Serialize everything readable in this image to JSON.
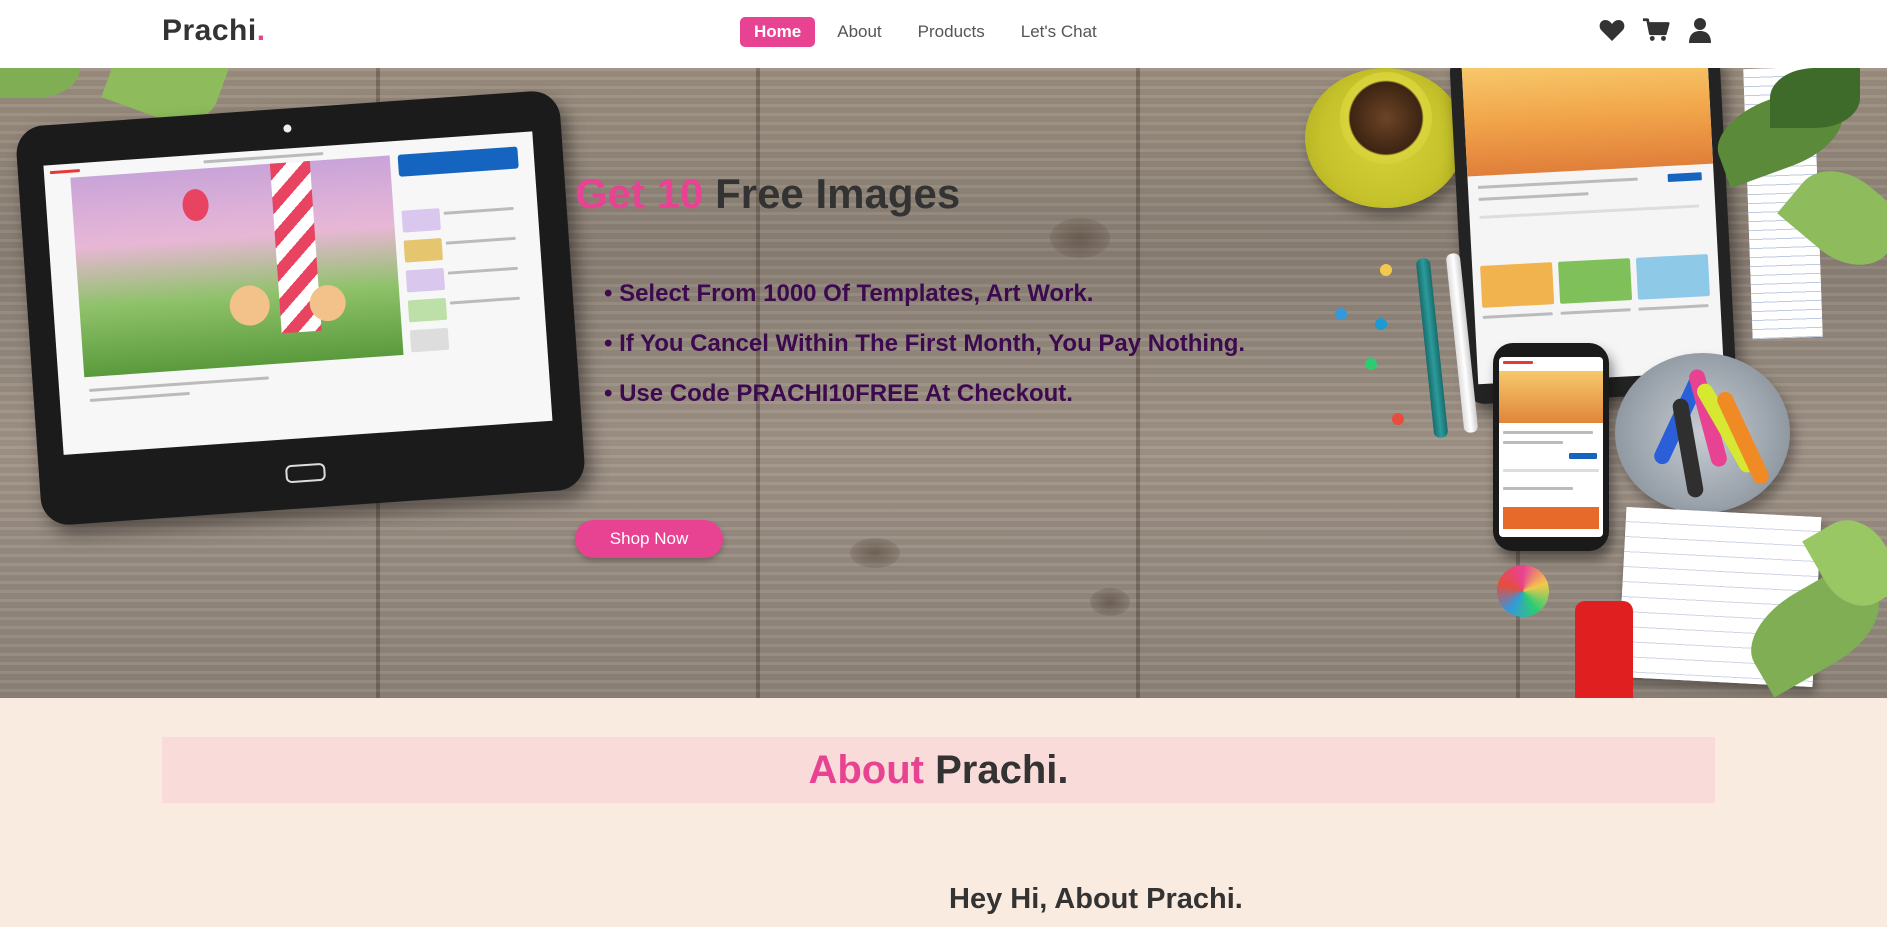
{
  "brand": {
    "name": "Prachi",
    "dot": ".",
    "accent_color": "#e84393"
  },
  "nav": {
    "links": [
      {
        "label": "Home",
        "active": true
      },
      {
        "label": "About",
        "active": false
      },
      {
        "label": "Products",
        "active": false
      },
      {
        "label": "Let's Chat",
        "active": false
      }
    ],
    "icons": [
      "heart-icon",
      "cart-icon",
      "user-icon"
    ]
  },
  "hero": {
    "title_accent": "Get 10",
    "title_rest": "Free Images",
    "bullets": [
      "• Select From 1000 Of Templates, Art Work.",
      "• If You Cancel Within The First Month, You Pay Nothing.",
      "• Use Code PRACHI10FREE At Checkout."
    ],
    "cta_label": "Shop Now"
  },
  "about": {
    "title_accent": "About",
    "title_rest": "Prachi.",
    "subheading": "Hey Hi, About Prachi."
  }
}
